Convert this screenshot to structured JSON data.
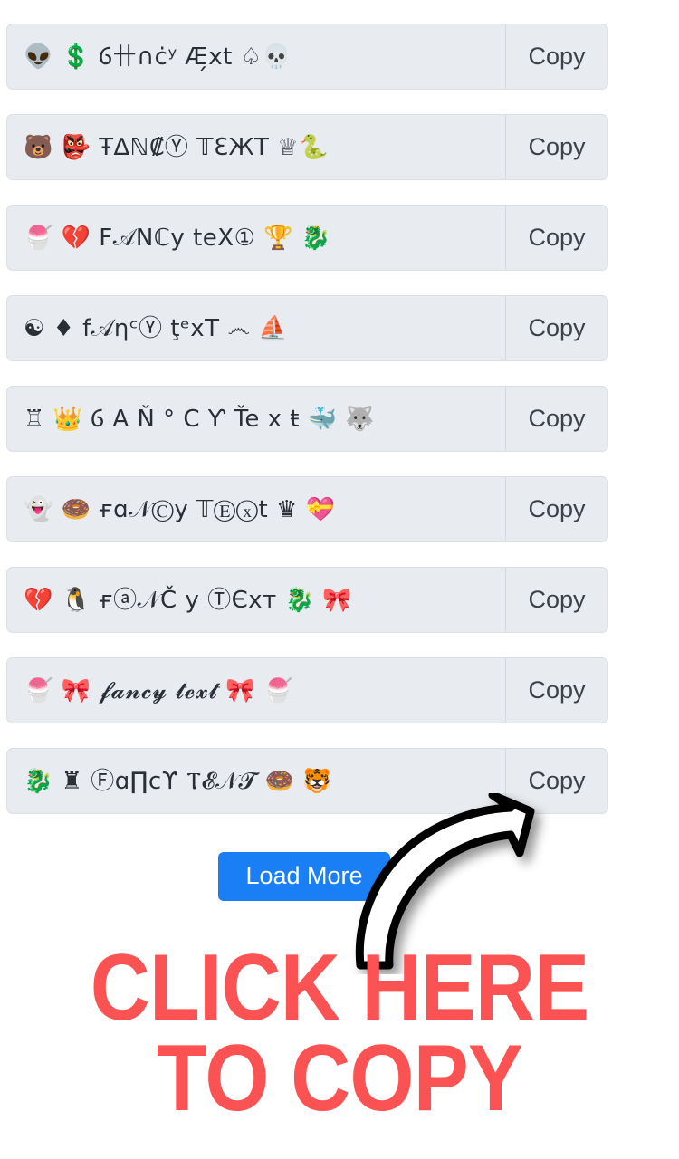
{
  "page": {
    "background_color": "#ffffff",
    "row_background_color": "#e8ecf0",
    "row_border_color": "#dbe0e5",
    "accent_button_color": "#1a7ef5",
    "callout_color": "#fb5353"
  },
  "list": {
    "copy_label": "Copy",
    "rows": [
      {
        "text": "👽 💲 Ⳓ卄∩ċʸ Æ̗xt ♤💀"
      },
      {
        "text": "🐻 👺 Ŧ∆ℕ₡Ⓨ 𝕋ƐЖT ♕🐍"
      },
      {
        "text": "🍧 💔 F𝒜Nℂy teX①  🏆 🐉"
      },
      {
        "text": "☯ ♦ f𝒜ηᶜⓎ ţᵉxT ෴ ⛵"
      },
      {
        "text": "♖ 👑 Ⳓ A Ň ° C Ƴ  Ťe x ŧ 🐳 🐺"
      },
      {
        "text": "👻 🍩 ғɑ𝒩Ⓒy 𝕋Ⓔⓧt ♛ 💝"
      },
      {
        "text": "💔 🐧 ғⓐ𝒩Č y ⓉЄхт 🐉 🎀"
      },
      {
        "text": "🍧 🎀 𝓯𝓪𝓷𝓬𝔂 𝓽𝓮𝔁𝓽 🎀 🍧"
      },
      {
        "text": "🐉 ♜ Ⓕɑ∏cϒ Ⲧ𝓔𝒩𝓣 🍩 🐯"
      }
    ]
  },
  "load_more": {
    "label": "Load More"
  },
  "callout": {
    "line1": "CLICK HERE",
    "line2": "TO COPY"
  },
  "arrow": {
    "name": "curved-up-right-arrow",
    "stroke_color": "#000000",
    "fill_color": "#ffffff"
  }
}
